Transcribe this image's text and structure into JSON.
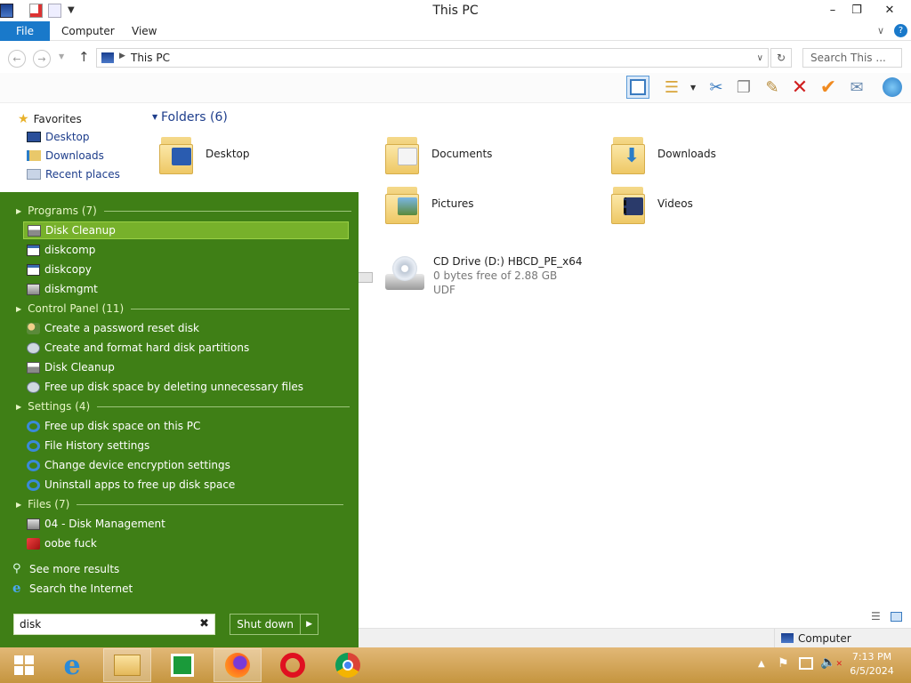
{
  "window": {
    "title": "This PC"
  },
  "ribbon": {
    "tabs": [
      "File",
      "Computer",
      "View"
    ]
  },
  "address": {
    "path": "This PC",
    "search_placeholder": "Search This ..."
  },
  "navpane": {
    "favorites_label": "Favorites",
    "items": [
      "Desktop",
      "Downloads",
      "Recent places"
    ]
  },
  "content": {
    "folders_header": "Folders (6)",
    "folders": [
      "Desktop",
      "Documents",
      "Downloads",
      "Pictures",
      "Videos"
    ],
    "cd_drive": {
      "name": "CD Drive (D:) HBCD_PE_x64",
      "space": "0 bytes free of 2.88 GB",
      "fs": "UDF"
    }
  },
  "statusbar": {
    "computer_label": "Computer"
  },
  "startmenu": {
    "sections": [
      {
        "label": "Programs (7)",
        "items": [
          "Disk Cleanup",
          "diskcomp",
          "diskcopy",
          "diskmgmt"
        ]
      },
      {
        "label": "Control Panel (11)",
        "items": [
          "Create a password reset disk",
          "Create and format hard disk partitions",
          "Disk Cleanup",
          "Free up disk space by deleting unnecessary files"
        ]
      },
      {
        "label": "Settings (4)",
        "items": [
          "Free up disk space on this PC",
          "File History settings",
          "Change device encryption settings",
          "Uninstall apps to free up disk space"
        ]
      },
      {
        "label": "Files (7)",
        "items": [
          "04 - Disk Management",
          "oobe fuck"
        ]
      }
    ],
    "see_more": "See more results",
    "search_internet": "Search the Internet",
    "search_value": "disk",
    "shutdown_label": "Shut down"
  },
  "taskbar": {
    "apps": [
      "start-icon",
      "internet-explorer-icon",
      "file-explorer-icon",
      "windows-store-icon",
      "firefox-icon",
      "opera-icon",
      "chrome-icon"
    ],
    "time": "7:13 PM",
    "date": "6/5/2024"
  },
  "colors": {
    "start_menu_bg": "#3f7f16",
    "highlight": "#77b12b",
    "taskbar": "#d4a85c",
    "file_tab": "#1979ca"
  }
}
